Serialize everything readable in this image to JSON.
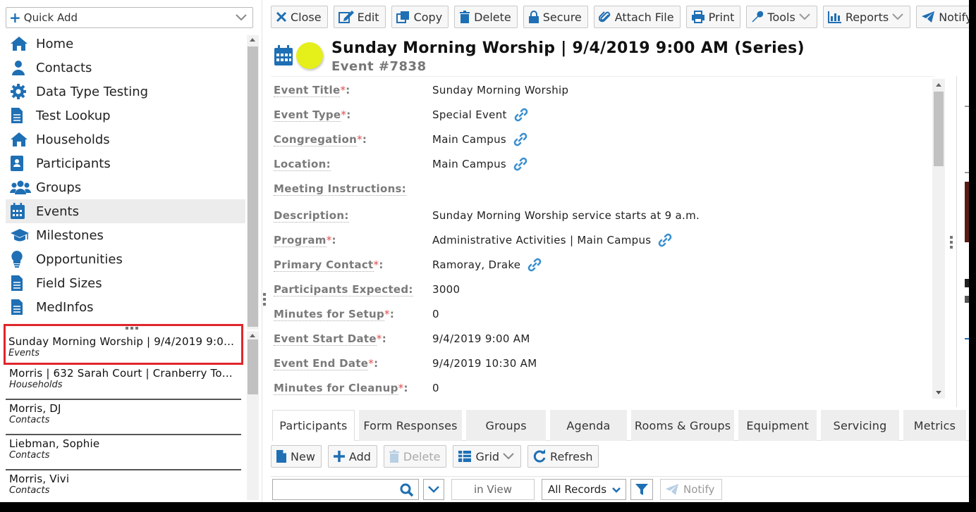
{
  "quick_add": {
    "label": "Quick Add"
  },
  "nav": {
    "items": [
      {
        "label": "Home",
        "icon": "home-icon"
      },
      {
        "label": "Contacts",
        "icon": "person-icon"
      },
      {
        "label": "Data Type Testing",
        "icon": "gear-icon"
      },
      {
        "label": "Test Lookup",
        "icon": "document-icon"
      },
      {
        "label": "Households",
        "icon": "home-icon"
      },
      {
        "label": "Participants",
        "icon": "id-badge-icon"
      },
      {
        "label": "Groups",
        "icon": "group-icon"
      },
      {
        "label": "Events",
        "icon": "calendar-icon"
      },
      {
        "label": "Milestones",
        "icon": "graduation-cap-icon"
      },
      {
        "label": "Opportunities",
        "icon": "lightbulb-icon"
      },
      {
        "label": "Field Sizes",
        "icon": "document-icon"
      },
      {
        "label": "MedInfos",
        "icon": "document-icon"
      }
    ],
    "active_index": 7
  },
  "recent": {
    "items": [
      {
        "title": "Sunday Morning Worship | 9/4/2019 9:00...",
        "type": "Events"
      },
      {
        "title": "Morris | 632 Sarah Court | Cranberry Tow...",
        "type": "Households"
      },
      {
        "title": "Morris, DJ",
        "type": "Contacts"
      },
      {
        "title": "Liebman, Sophie",
        "type": "Contacts"
      },
      {
        "title": "Morris, Vivi",
        "type": "Contacts"
      }
    ]
  },
  "toolbar": {
    "close": "Close",
    "edit": "Edit",
    "copy": "Copy",
    "delete": "Delete",
    "secure": "Secure",
    "attach": "Attach File",
    "print": "Print",
    "tools": "Tools",
    "reports": "Reports",
    "notify": "Notify"
  },
  "record": {
    "title": "Sunday Morning Worship | 9/4/2019 9:00 AM  (Series)",
    "subtitle": "Event #7838",
    "status_color": "#e5ef1a"
  },
  "fields": [
    {
      "label": "Event Title",
      "required": true,
      "value": "Sunday Morning Worship",
      "link": false
    },
    {
      "label": "Event Type",
      "required": true,
      "value": "Special Event",
      "link": true
    },
    {
      "label": "Congregation",
      "required": true,
      "value": "Main Campus",
      "link": true
    },
    {
      "label": "Location:",
      "required": false,
      "value": "Main Campus",
      "link": true
    },
    {
      "label": "Meeting Instructions:",
      "required": false,
      "value": "",
      "link": false
    },
    {
      "label": "Description:",
      "required": false,
      "value": "Sunday Morning Worship service starts at 9 a.m.",
      "link": false
    },
    {
      "label": "Program",
      "required": true,
      "value": "Administrative Activities | Main Campus",
      "link": true
    },
    {
      "label": "Primary Contact",
      "required": true,
      "value": "Ramoray, Drake",
      "link": true
    },
    {
      "label": "Participants Expected:",
      "required": false,
      "value": "3000",
      "link": false
    },
    {
      "label": "Minutes for Setup",
      "required": true,
      "value": "0",
      "link": false
    },
    {
      "label": "Event Start Date",
      "required": true,
      "value": "9/4/2019 9:00 AM",
      "link": false
    },
    {
      "label": "Event End Date",
      "required": true,
      "value": "9/4/2019 10:30 AM",
      "link": false
    },
    {
      "label": "Minutes for Cleanup",
      "required": true,
      "value": "0",
      "link": false
    }
  ],
  "required_marker": "*",
  "label_suffix": ":",
  "tabs": [
    "Participants",
    "Form Responses",
    "Groups",
    "Agenda",
    "Rooms & Groups",
    "Equipment",
    "Servicing",
    "Metrics"
  ],
  "subbar": {
    "new": "New",
    "add": "Add",
    "delete": "Delete",
    "grid": "Grid",
    "refresh": "Refresh"
  },
  "filter": {
    "search_value": "",
    "in_view": "in View",
    "records": "All Records",
    "notify": "Notify"
  },
  "colors": {
    "accent": "#1e6fb4",
    "link": "#3a8fd0",
    "required": "#e24c4c",
    "selected_outline": "#e0262b"
  }
}
